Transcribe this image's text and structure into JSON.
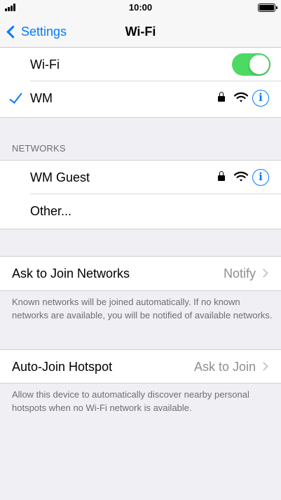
{
  "status_bar": {
    "time": "10:00"
  },
  "nav": {
    "back_label": "Settings",
    "title": "Wi-Fi"
  },
  "wifi_group": {
    "wifi_label": "Wi-Fi",
    "wifi_enabled": true,
    "connected_network": "WM",
    "toggle_color": "#4cd964"
  },
  "networks": {
    "header": "NETWORKS",
    "items": [
      {
        "name": "WM Guest",
        "secured": true
      },
      {
        "name": "Other..."
      }
    ]
  },
  "ask_to_join": {
    "label": "Ask to Join Networks",
    "value": "Notify",
    "footer": "Known networks will be joined automatically. If no known networks are available, you will be notified of available networks."
  },
  "auto_join": {
    "label": "Auto-Join Hotspot",
    "value": "Ask to Join",
    "footer": "Allow this device to automatically discover nearby personal hotspots when no Wi-Fi network is available."
  },
  "accent_color": "#007aff",
  "icons": [
    "signal-icon",
    "battery-icon",
    "back-chevron-icon",
    "check-icon",
    "lock-icon",
    "wifi-icon",
    "info-icon",
    "chevron-right-icon"
  ]
}
